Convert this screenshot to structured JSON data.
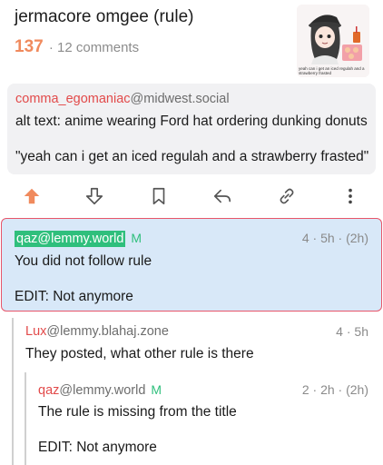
{
  "post": {
    "title": "jermacore omgee (rule)",
    "score": "137",
    "separator": "·",
    "comments": "12 comments",
    "thumbnail_caption": "yeah can i get an iced regulah and a strawberry frasted"
  },
  "alt_comment": {
    "user": "comma_egomaniac",
    "instance": "@midwest.social",
    "line1": "alt text: anime wearing Ford hat ordering dunking donuts",
    "line2": "\"yeah can i get an iced regulah and a strawberry frasted\""
  },
  "actions": [
    {
      "name": "upvote",
      "icon": "arrow-up-icon"
    },
    {
      "name": "downvote",
      "icon": "arrow-down-icon"
    },
    {
      "name": "save",
      "icon": "bookmark-icon"
    },
    {
      "name": "reply",
      "icon": "reply-icon"
    },
    {
      "name": "link",
      "icon": "link-icon"
    },
    {
      "name": "more",
      "icon": "more-vertical-icon"
    }
  ],
  "comments": [
    {
      "user": "qaz",
      "instance": "@lemmy.world",
      "badge": "M",
      "score": "4",
      "time": "5h",
      "edited": "(2h)",
      "body1": "You did not follow rule",
      "body2": "EDIT: Not anymore"
    },
    {
      "user": "Lux",
      "instance": "@lemmy.blahaj.zone",
      "score": "4",
      "time": "5h",
      "body1": "They posted, what other rule is there"
    },
    {
      "user": "qaz",
      "instance": "@lemmy.world",
      "badge": "M",
      "score": "2",
      "time": "2h",
      "edited": "(2h)",
      "body1": "The rule is missing from the title",
      "body2": "EDIT: Not anymore"
    }
  ],
  "colors": {
    "accent": "#f08a5d",
    "author": "#e24a4a",
    "moderator": "#2fbf7c",
    "highlight": "#d8e8f8"
  }
}
